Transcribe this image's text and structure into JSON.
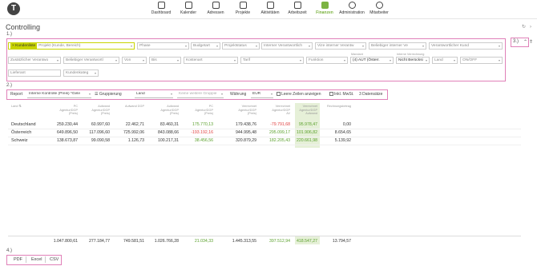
{
  "app": {
    "logo_letter": "T",
    "page_title": "Controlling"
  },
  "nav": [
    {
      "label": "Dashboard",
      "icon": "dashboard-icon"
    },
    {
      "label": "Kalender",
      "icon": "calendar-icon"
    },
    {
      "label": "Adressen",
      "icon": "address-icon"
    },
    {
      "label": "Projekte",
      "icon": "projects-icon"
    },
    {
      "label": "Aktivitäten",
      "icon": "activities-icon"
    },
    {
      "label": "Arbeitszeit",
      "icon": "worktime-icon"
    },
    {
      "label": "Finanzen",
      "icon": "finance-icon",
      "active": true
    },
    {
      "label": "Administration",
      "icon": "gear-icon"
    },
    {
      "label": "Mitarbeiter",
      "icon": "staff-icon"
    }
  ],
  "sections": {
    "s1": "1.)",
    "s2": "2.)",
    "s3": "3.)",
    "s4": "4.)"
  },
  "filters": {
    "chip": "× Kundenliste",
    "project_placeholder": "Projekt (Kunde, Bereich)",
    "phase": "Phase",
    "budgetart": "Budgetart",
    "projektstatus": "Projektstatus",
    "interner_verantwortlicher": "Interner Verantwortlich",
    "vize_interner": "Vize interner Verantw",
    "beliebiger_interner": "Beliebiger interner Ve",
    "verantwortlicher_kunde": "Verantwortlicher Kund",
    "zusaetzlicher": "Zusätzlicher Verantwo",
    "beliebiger_verantwortlich": "Beliebiger Verantwortl",
    "von": "Von",
    "bis": "Bis",
    "kostenart": "Kostenart",
    "tarif": "Tarif",
    "funktion": "Funktion",
    "mandant_label": "Mandant",
    "mandant_value": "(4) AUT (Österr.",
    "interne_label": "Interne Verrechnung",
    "interne_value": "Nicht Berücksi",
    "land": "Land",
    "onoff": "ON/OFF",
    "lieferant": "Lieferant",
    "kundenkategorie": "Kundenkateg"
  },
  "report": {
    "report_label": "Report",
    "report_value": "Interne Kontrolle (Preis) *Gele",
    "gruppierung_label": "Gruppierung",
    "gruppierung_value": "Land",
    "gruppe2_placeholder": "Keine weitere Gruppie",
    "waehrung_label": "Währung",
    "waehrung_value": "EUR",
    "leere_zeilen": "Leere Zeilen anzeigen",
    "inkl_mwst": "Inkl. MwSt.",
    "datensaetze": "3 Datensätze"
  },
  "table": {
    "col0": "Land",
    "headers": [
      [
        "PC",
        "Agentur/DGP",
        "(Preis)"
      ],
      [
        "Aufwand",
        "Agentur/DGP",
        "(Preis)"
      ],
      [
        "Aufwand DGP"
      ],
      [
        "Aufwand",
        "Agentur/DGP",
        "(Preis)"
      ],
      [
        "PC",
        "Agentur/DGP",
        "(Preis)"
      ],
      [
        "Verrechnet",
        "Agentur/DGP",
        "(Preis)"
      ],
      [
        "Verrechnet",
        "Agentur/DGP",
        "AV"
      ],
      [
        "Verrechnet",
        "Agentur/DGP",
        "Aufwand"
      ],
      [
        "Rechnungsbetrag"
      ]
    ],
    "rows": [
      {
        "label": "Deutschland",
        "values": [
          "259.230,44",
          "60.997,60",
          "22.462,71",
          "83.460,31",
          "175.770,13",
          "179.438,76",
          "-79.791,68",
          "95.978,47",
          "0,00"
        ]
      },
      {
        "label": "Österreich",
        "values": [
          "649.896,50",
          "117.096,60",
          "725.992,06",
          "843.088,66",
          "-193.192,16",
          "944.995,48",
          "295.099,17",
          "101.906,82",
          "8.654,65"
        ]
      },
      {
        "label": "Schweiz",
        "values": [
          "138.673,87",
          "99.090,58",
          "1.126,73",
          "100.217,31",
          "38.456,56",
          "320.879,29",
          "182.205,43",
          "220.661,98",
          "5.139,92"
        ]
      }
    ],
    "totals": [
      "1.047.800,61",
      "277.184,77",
      "749.581,51",
      "1.026.766,28",
      "21.034,33",
      "1.445.313,55",
      "397.512,94",
      "418.547,27",
      "13.794,57"
    ]
  },
  "export": {
    "pdf": "PDF",
    "excel": "Excel",
    "csv": "CSV"
  },
  "colors": {
    "accent": "#7cb342",
    "highlight": "#c8d400",
    "frame": "#e080b8",
    "positive": "#5aa02c",
    "negative": "#e04040"
  }
}
